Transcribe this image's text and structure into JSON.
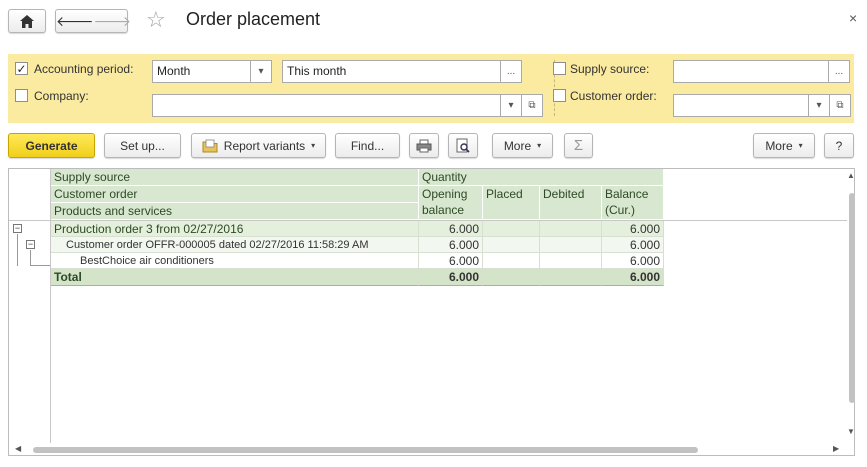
{
  "window": {
    "title": "Order placement",
    "close_glyph": "×",
    "home_icon": "home-icon",
    "back_glyph": "🡐",
    "forward_glyph": "🡒",
    "star_glyph": "☆"
  },
  "filters": {
    "accounting_period": {
      "label": "Accounting period:",
      "checked": true,
      "period_type": "Month",
      "period_value": "This month"
    },
    "company": {
      "label": "Company:",
      "checked": false,
      "value": ""
    },
    "supply_source": {
      "label": "Supply source:",
      "checked": false,
      "value": ""
    },
    "customer_order": {
      "label": "Customer order:",
      "checked": false,
      "value": ""
    },
    "ellipsis": "...",
    "dropdown_glyph": "▾",
    "open_glyph": "⧉",
    "check_glyph": "✓"
  },
  "toolbar": {
    "generate": "Generate",
    "setup": "Set up...",
    "report_variants": "Report variants",
    "find": "Find...",
    "more_left": "More",
    "sum_glyph": "Σ",
    "more_right": "More",
    "help": "?",
    "caret": "▾"
  },
  "report": {
    "header": {
      "row_groups": [
        "Supply source",
        "Customer order",
        "Products and services"
      ],
      "quantity": "Quantity",
      "columns": [
        "Opening balance",
        "Placed",
        "Debited",
        "Balance (Cur.)"
      ]
    },
    "rows": [
      {
        "label": "Production order 3 from 02/27/2016",
        "opening": "6.000",
        "placed": "",
        "debited": "",
        "balance": "6.000"
      },
      {
        "label": "Customer order OFFR-000005 dated 02/27/2016 11:58:29 AM",
        "opening": "6.000",
        "placed": "",
        "debited": "",
        "balance": "6.000"
      },
      {
        "label": "BestChoice air conditioners",
        "opening": "6.000",
        "placed": "",
        "debited": "",
        "balance": "6.000"
      }
    ],
    "total": {
      "label": "Total",
      "opening": "6.000",
      "placed": "",
      "debited": "",
      "balance": "6.000"
    },
    "tree_minus": "−"
  },
  "colors": {
    "accent_yellow": "#f1cf1a",
    "filter_bg": "#fbeba0",
    "header_green": "#d8e7cf",
    "row1_green": "#e4f0dc",
    "row2_green": "#f2f7ef",
    "total_green": "#d3e4c8"
  }
}
